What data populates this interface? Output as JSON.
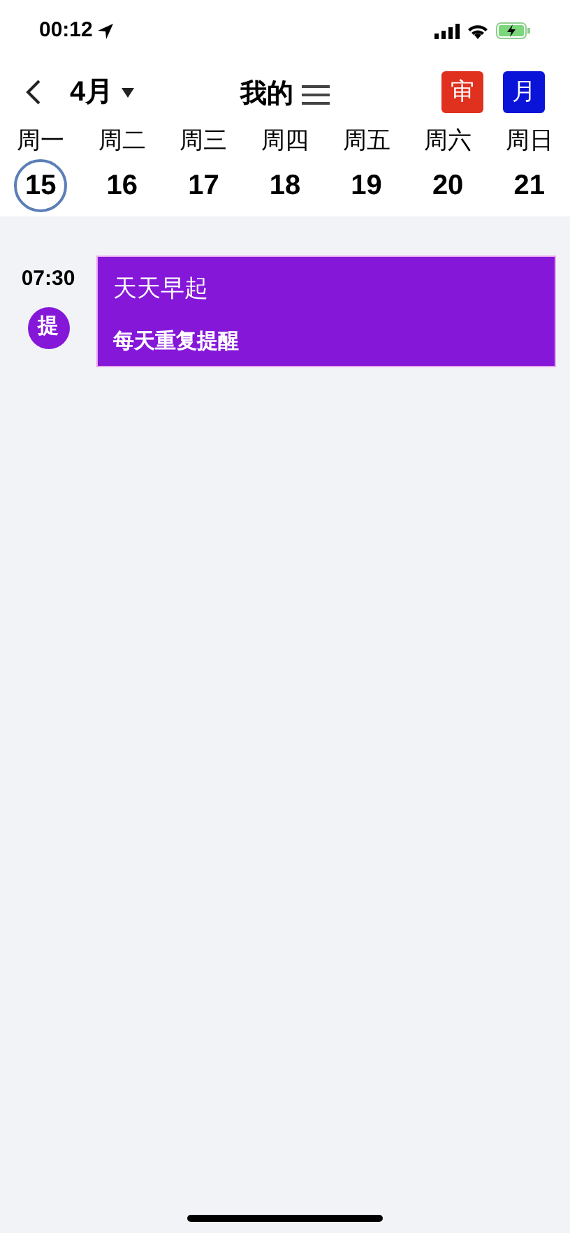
{
  "status_bar": {
    "time": "00:12"
  },
  "header": {
    "month": "4月",
    "title": "我的",
    "buttons": [
      {
        "label": "审",
        "color": "#e0301e"
      },
      {
        "label": "月",
        "color": "#0a14d8"
      }
    ]
  },
  "week": [
    {
      "weekday": "周一",
      "date": "15",
      "selected": true
    },
    {
      "weekday": "周二",
      "date": "16",
      "selected": false
    },
    {
      "weekday": "周三",
      "date": "17",
      "selected": false
    },
    {
      "weekday": "周四",
      "date": "18",
      "selected": false
    },
    {
      "weekday": "周五",
      "date": "19",
      "selected": false
    },
    {
      "weekday": "周六",
      "date": "20",
      "selected": false
    },
    {
      "weekday": "周日",
      "date": "21",
      "selected": false
    }
  ],
  "events": [
    {
      "time": "07:30",
      "badge": "提",
      "title": "天天早起",
      "subtitle": "每天重复提醒",
      "color": "#8517d9"
    }
  ]
}
